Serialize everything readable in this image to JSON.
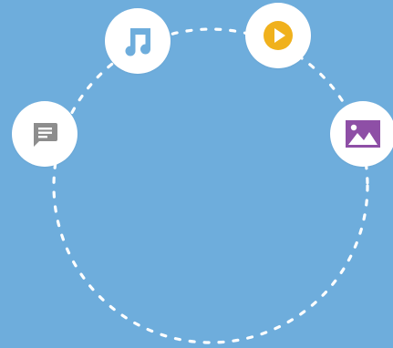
{
  "colors": {
    "background": "#6eaddc",
    "bubble": "#ffffff",
    "ring_dash": "#ffffff",
    "chat_icon": "#8d8d8d",
    "music_icon": "#6eaddc",
    "play_icon": "#f0b11d",
    "image_icon": "#8e4fa6"
  },
  "icons": [
    {
      "name": "chat-icon",
      "label": "message"
    },
    {
      "name": "music-note-icon",
      "label": "music"
    },
    {
      "name": "play-icon",
      "label": "video"
    },
    {
      "name": "image-icon",
      "label": "photo"
    }
  ]
}
